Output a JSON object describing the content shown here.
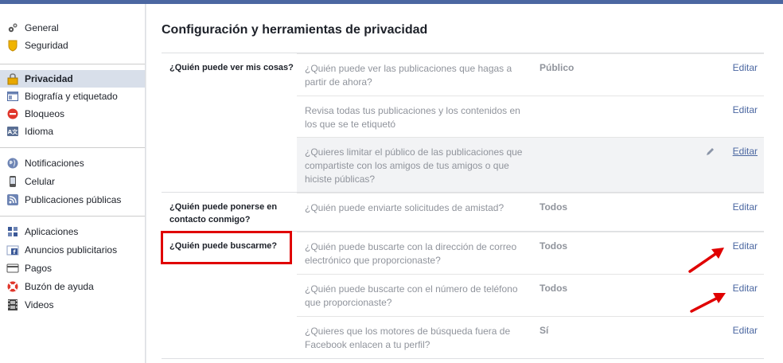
{
  "sidebar": {
    "groups": [
      [
        {
          "label": "General",
          "icon": "gears-icon"
        },
        {
          "label": "Seguridad",
          "icon": "shield-icon"
        }
      ],
      [
        {
          "label": "Privacidad",
          "icon": "lock-icon",
          "active": true
        },
        {
          "label": "Biografía y etiquetado",
          "icon": "timeline-icon"
        },
        {
          "label": "Bloqueos",
          "icon": "block-icon"
        },
        {
          "label": "Idioma",
          "icon": "language-icon"
        }
      ],
      [
        {
          "label": "Notificaciones",
          "icon": "globe-icon"
        },
        {
          "label": "Celular",
          "icon": "phone-icon"
        },
        {
          "label": "Publicaciones públicas",
          "icon": "rss-icon"
        }
      ],
      [
        {
          "label": "Aplicaciones",
          "icon": "apps-icon"
        },
        {
          "label": "Anuncios publicitarios",
          "icon": "ads-icon"
        },
        {
          "label": "Pagos",
          "icon": "card-icon"
        },
        {
          "label": "Buzón de ayuda",
          "icon": "lifebuoy-icon"
        },
        {
          "label": "Videos",
          "icon": "film-icon"
        }
      ]
    ]
  },
  "main": {
    "title": "Configuración y herramientas de privacidad",
    "sections": [
      {
        "label": "¿Quién puede ver mis cosas?",
        "rows": [
          {
            "question": "¿Quién puede ver las publicaciones que hagas a partir de ahora?",
            "value": "Público",
            "edit": "Editar"
          },
          {
            "question": "Revisa todas tus publicaciones y los contenidos en los que se te etiquetó",
            "value": "",
            "edit": "Editar"
          },
          {
            "question": "¿Quieres limitar el público de las publicaciones que compartiste con los amigos de tus amigos o que hiciste públicas?",
            "value": "",
            "edit": "Editar"
          }
        ]
      },
      {
        "label": "¿Quién puede ponerse en contacto conmigo?",
        "rows": [
          {
            "question": "¿Quién puede enviarte solicitudes de amistad?",
            "value": "Todos",
            "edit": "Editar"
          }
        ]
      },
      {
        "label": "¿Quién puede buscarme?",
        "rows": [
          {
            "question": "¿Quién puede buscarte con la dirección de correo electrónico que proporcionaste?",
            "value": "Todos",
            "edit": "Editar"
          },
          {
            "question": "¿Quién puede buscarte con el número de teléfono que proporcionaste?",
            "value": "Todos",
            "edit": "Editar"
          },
          {
            "question": "¿Quieres que los motores de búsqueda fuera de Facebook enlacen a tu perfil?",
            "value": "Sí",
            "edit": "Editar"
          }
        ]
      }
    ]
  },
  "colors": {
    "link": "#4b67a1",
    "annotation": "#e00000",
    "active_bg": "#d8dfea"
  }
}
